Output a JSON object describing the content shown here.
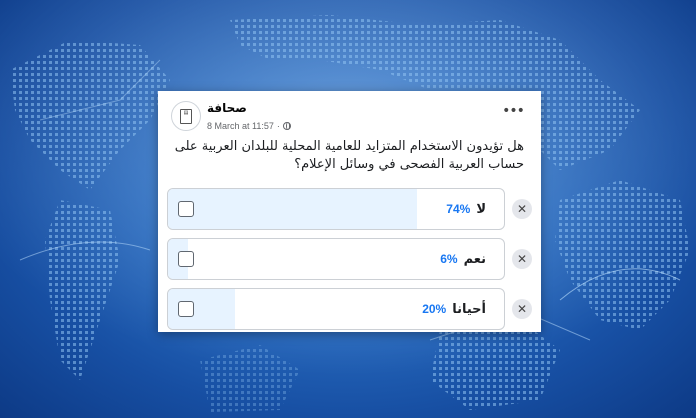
{
  "post": {
    "page_name": "صحافة",
    "timestamp": "8 March at 11:57",
    "separator": "·",
    "audience_icon": "globe-icon",
    "more_icon": "•••",
    "question": "هل تؤيدون الاستخدام المتزايد للعامية المحلية للبلدان العربية على حساب العربية الفصحى في وسائل الإعلام؟"
  },
  "poll": {
    "options": [
      {
        "label": "لا",
        "percent": "74%",
        "share": 0.74
      },
      {
        "label": "نعم",
        "percent": "6%",
        "share": 0.06
      },
      {
        "label": "أحيانا",
        "percent": "20%",
        "share": 0.2
      }
    ],
    "remove_icon": "✕",
    "fill_color": "#e7f3ff",
    "accent_color": "#1877f2"
  }
}
